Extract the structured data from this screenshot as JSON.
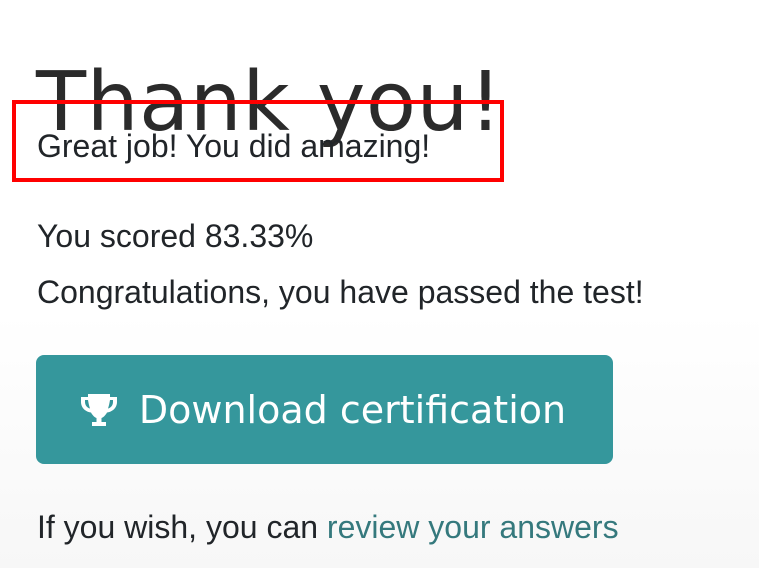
{
  "page": {
    "title": "Thank you!",
    "quiz_message": "Great job! You did amazing!",
    "score_text": "You scored 83.33%",
    "score_percent": 83.33,
    "pass_message": "Congratulations, you have passed the test!",
    "download_button_label": "Download certification",
    "download_button_icon": "trophy-icon",
    "review_prefix": "If you wish, you can ",
    "review_link_text": "review your answers"
  },
  "colors": {
    "primary_button": "#35979c",
    "link": "#35797d",
    "highlight_border": "#ff0000",
    "text": "#212529"
  }
}
